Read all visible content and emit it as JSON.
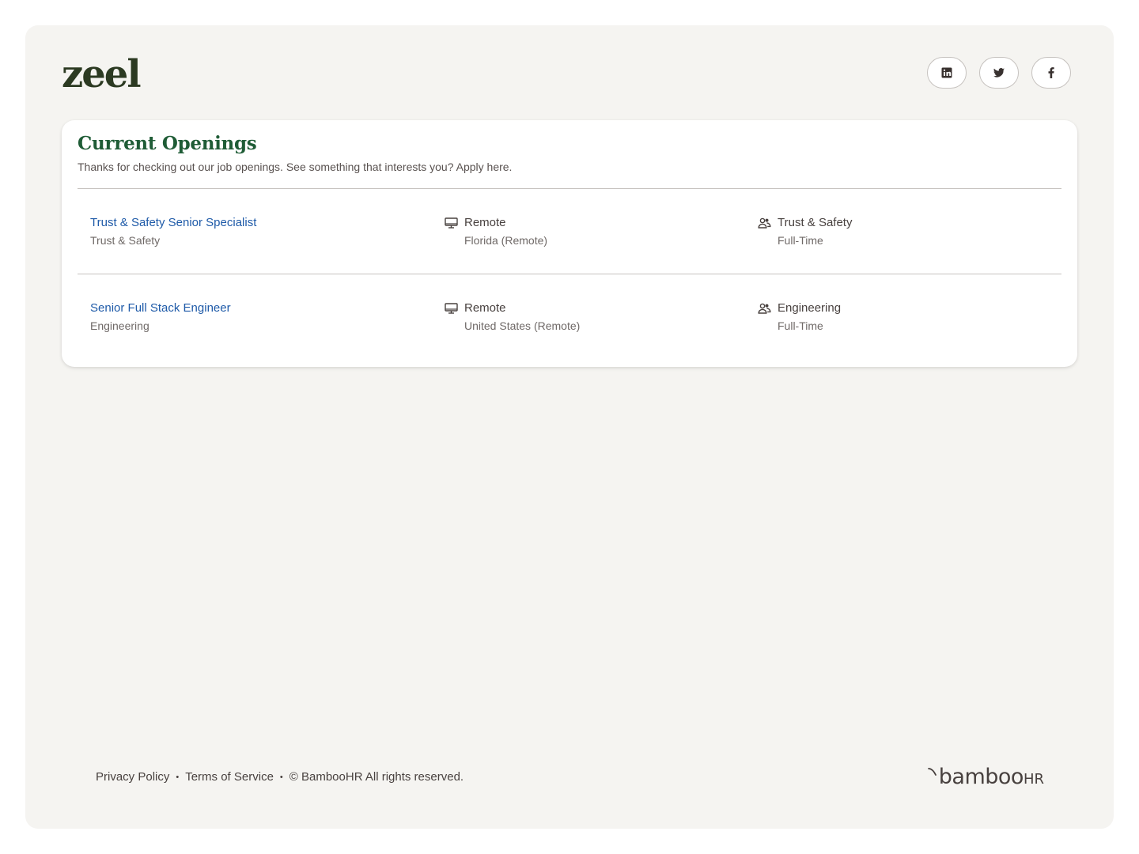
{
  "brand": {
    "logo_text": "zeel"
  },
  "social": {
    "linkedin": {
      "icon": "linkedin-icon"
    },
    "twitter": {
      "icon": "twitter-icon"
    },
    "facebook": {
      "icon": "facebook-icon"
    }
  },
  "openings": {
    "title": "Current Openings",
    "subtitle": "Thanks for checking out our job openings. See something that interests you? Apply here.",
    "jobs": [
      {
        "title": "Trust & Safety Senior Specialist",
        "department_sub": "Trust & Safety",
        "location_type": "Remote",
        "location": "Florida (Remote)",
        "department": "Trust & Safety",
        "employment_type": "Full-Time"
      },
      {
        "title": "Senior Full Stack Engineer",
        "department_sub": "Engineering",
        "location_type": "Remote",
        "location": "United States (Remote)",
        "department": "Engineering",
        "employment_type": "Full-Time"
      }
    ]
  },
  "footer": {
    "privacy": "Privacy Policy",
    "separator": "•",
    "terms": "Terms of Service",
    "copyright": "© BambooHR All rights reserved.",
    "powered_by_main": "bamboo",
    "powered_by_suffix": "HR"
  },
  "colors": {
    "accent_green": "#1f5c36",
    "link_blue": "#1e5aa8",
    "page_bg": "#f5f4f1"
  }
}
